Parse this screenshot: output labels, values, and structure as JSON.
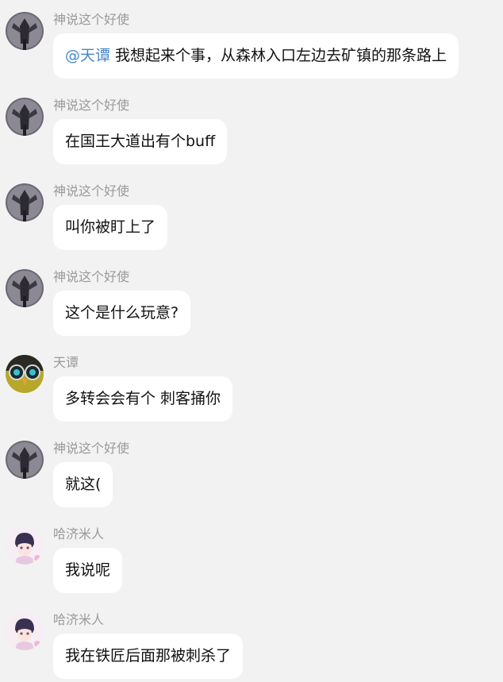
{
  "users": {
    "shenshuo": {
      "name": "神说这个好使",
      "avatar_icon": "hooded-figure-avatar-icon"
    },
    "tiantan": {
      "name": "天谭",
      "avatar_icon": "owl-avatar-icon"
    },
    "hajimiren": {
      "name": "哈济米人",
      "avatar_icon": "anime-boy-avatar-icon"
    }
  },
  "messages": [
    {
      "sender": "神说这个好使",
      "mention": "@天谭",
      "text": " 我想起来个事，从森林入口左边去矿镇的那条路上"
    },
    {
      "sender": "神说这个好使",
      "mention": "",
      "text": "在国王大道出有个buff"
    },
    {
      "sender": "神说这个好使",
      "mention": "",
      "text": "叫你被盯上了"
    },
    {
      "sender": "神说这个好使",
      "mention": "",
      "text": "这个是什么玩意?"
    },
    {
      "sender": "天谭",
      "mention": "",
      "text": "多转会会有个 刺客捅你"
    },
    {
      "sender": "神说这个好使",
      "mention": "",
      "text": "就这("
    },
    {
      "sender": "哈济米人",
      "mention": "",
      "text": "我说呢"
    },
    {
      "sender": "哈济米人",
      "mention": "",
      "text": "我在铁匠后面那被刺杀了"
    }
  ],
  "colors": {
    "background": "#f2f2f2",
    "bubble": "#ffffff",
    "sender_name": "#9a9a9a",
    "mention": "#4a86c8"
  }
}
